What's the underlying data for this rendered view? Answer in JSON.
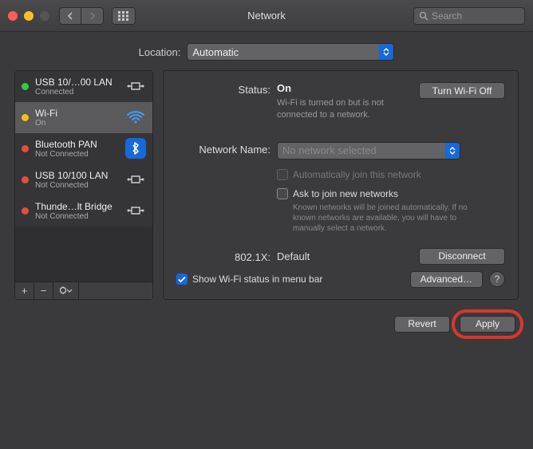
{
  "window": {
    "title": "Network",
    "searchPlaceholder": "Search"
  },
  "location": {
    "label": "Location:",
    "value": "Automatic"
  },
  "sidebar": {
    "items": [
      {
        "name": "USB 10/…00 LAN",
        "sub": "Connected",
        "status": "green",
        "icon": "ethernet"
      },
      {
        "name": "Wi-Fi",
        "sub": "On",
        "status": "yellow",
        "icon": "wifi",
        "selected": true
      },
      {
        "name": "Bluetooth PAN",
        "sub": "Not Connected",
        "status": "red",
        "icon": "bluetooth"
      },
      {
        "name": "USB 10/100 LAN",
        "sub": "Not Connected",
        "status": "red",
        "icon": "ethernet"
      },
      {
        "name": "Thunde…lt Bridge",
        "sub": "Not Connected",
        "status": "red",
        "icon": "ethernet"
      }
    ]
  },
  "detail": {
    "statusLabel": "Status:",
    "statusValue": "On",
    "turnOff": "Turn Wi-Fi Off",
    "statusDesc": "Wi-Fi is turned on but is not connected to a network.",
    "networkNameLabel": "Network Name:",
    "networkNamePlaceholder": "No network selected",
    "autoJoin": "Automatically join this network",
    "askJoin": "Ask to join new networks",
    "askJoinDesc": "Known networks will be joined automatically. If no known networks are available, you will have to manually select a network.",
    "dot1xLabel": "802.1X:",
    "dot1xValue": "Default",
    "disconnect": "Disconnect",
    "showStatus": "Show Wi-Fi status in menu bar",
    "advanced": "Advanced…"
  },
  "actions": {
    "revert": "Revert",
    "apply": "Apply"
  }
}
